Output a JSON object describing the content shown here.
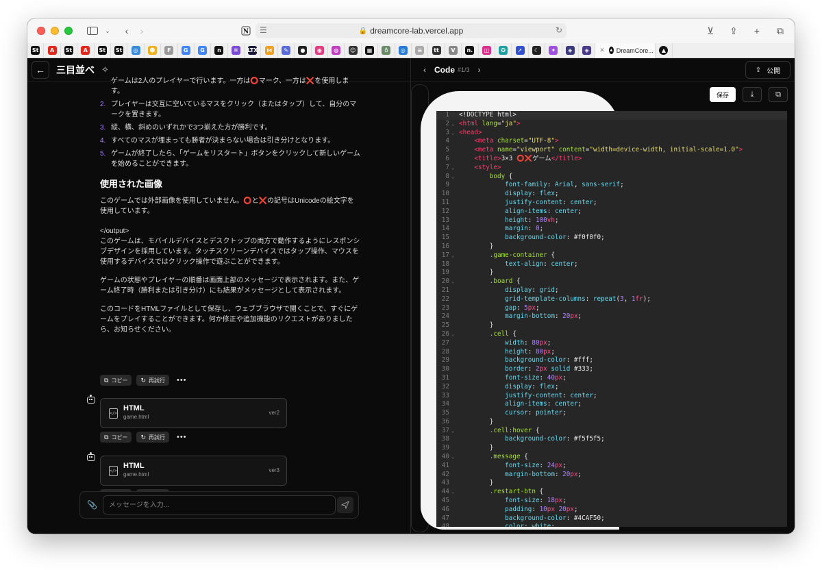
{
  "browser": {
    "url": "dreamcore-lab.vercel.app",
    "tab_title": "DreamCore...",
    "favorites": [
      {
        "label": "St",
        "color": "#111111"
      },
      {
        "label": "A",
        "color": "#e0281d"
      },
      {
        "label": "St",
        "color": "#111111"
      },
      {
        "label": "A",
        "color": "#e0281d"
      },
      {
        "label": "St",
        "color": "#111111"
      },
      {
        "label": "St",
        "color": "#111111"
      },
      {
        "label": "◎",
        "color": "#3a8bdc"
      },
      {
        "label": "☻",
        "color": "#f0b020"
      },
      {
        "label": "F",
        "color": "#9a9a9a"
      },
      {
        "label": "G",
        "color": "#4285f4"
      },
      {
        "label": "G",
        "color": "#4285f4"
      },
      {
        "label": "n",
        "color": "#111111"
      },
      {
        "label": "✲",
        "color": "#7b4bd8"
      },
      {
        "label": "LTX",
        "color": "#1a1a3a"
      },
      {
        "label": "⋈",
        "color": "#f0a020"
      },
      {
        "label": "✎",
        "color": "#5a6ad8"
      },
      {
        "label": "●",
        "color": "#222222"
      },
      {
        "label": "◉",
        "color": "#e04080"
      },
      {
        "label": "◍",
        "color": "#c040c0"
      },
      {
        "label": "☺",
        "color": "#333333"
      },
      {
        "label": "▦",
        "color": "#111111"
      },
      {
        "label": "♁",
        "color": "#6a8a6a"
      },
      {
        "label": "◎",
        "color": "#2a7ad8"
      },
      {
        "label": "≡",
        "color": "#aaaaaa"
      },
      {
        "label": "tt",
        "color": "#333333"
      },
      {
        "label": "V",
        "color": "#888888"
      },
      {
        "label": "n.",
        "color": "#111111"
      },
      {
        "label": "◫",
        "color": "#d8308a"
      },
      {
        "label": "✪",
        "color": "#20a0a0"
      },
      {
        "label": "➚",
        "color": "#3050d0"
      },
      {
        "label": "☾",
        "color": "#222222"
      },
      {
        "label": "✦",
        "color": "#a050e0"
      },
      {
        "label": "◈",
        "color": "#3a3a7a"
      },
      {
        "label": "◈",
        "color": "#4a3a8a"
      }
    ]
  },
  "chat": {
    "title": "三目並べ",
    "list_items": [
      {
        "num": "",
        "text": "ゲームは2人のプレイヤーで行います。一方は⭕マーク、一方は❌を使用します。"
      },
      {
        "num": "2.",
        "text": "プレイヤーは交互に空いているマスをクリック（またはタップ）して、自分のマークを置きます。"
      },
      {
        "num": "3.",
        "text": "縦、横、斜めのいずれかで3つ揃えた方が勝利です。"
      },
      {
        "num": "4.",
        "text": "すべてのマスが埋まっても勝者が決まらない場合は引き分けとなります。"
      },
      {
        "num": "5.",
        "text": "ゲームが終了したら、「ゲームをリスタート」ボタンをクリックして新しいゲームを始めることができます。"
      }
    ],
    "section_heading": "使用された画像",
    "images_para_a": "このゲームでは外部画像を使用していません。",
    "images_para_o": "⭕",
    "images_para_to": "と",
    "images_para_x": "❌",
    "images_para_b": "の記号はUnicodeの絵文字を使用しています。",
    "output_tag": "</output>",
    "para1": "このゲームは、モバイルデバイスとデスクトップの両方で動作するようにレスポンシブデザインを採用しています。タッチスクリーンデバイスではタップ操作、マウスを使用するデバイスではクリック操作で遊ぶことができます。",
    "para2": "ゲームの状態やプレイヤーの順番は画面上部のメッセージで表示されます。また、ゲーム終了時（勝利または引き分け）にも結果がメッセージとして表示されます。",
    "para3": "このコードをHTMLファイルとして保存し、ウェブブラウザで開くことで、すぐにゲームをプレイすることができます。何か修正や追加機能のリクエストがありましたら、お知らせください。",
    "copy_label": "コピー",
    "retry_label": "再試行",
    "more_label": "•••",
    "cards": [
      {
        "type": "HTML",
        "file": "game.html",
        "version": "ver2"
      },
      {
        "type": "HTML",
        "file": "game.html",
        "version": "ver3"
      }
    ],
    "input_placeholder": "メッセージを入力..."
  },
  "code_panel": {
    "title": "Code",
    "version": "#1/3",
    "publish_label": "公開",
    "save_label": "保存",
    "lines": [
      [
        [
          "plain",
          "<!DOCTYPE html>"
        ]
      ],
      [
        [
          "tag",
          "<html "
        ],
        [
          "attr",
          "lang"
        ],
        [
          "plain",
          "="
        ],
        [
          "str",
          "\"ja\""
        ],
        [
          "tag",
          ">"
        ]
      ],
      [
        [
          "tag",
          "<head>"
        ]
      ],
      [
        [
          "plain",
          "    "
        ],
        [
          "tag",
          "<meta "
        ],
        [
          "attr",
          "charset"
        ],
        [
          "plain",
          "="
        ],
        [
          "str",
          "\"UTF-8\""
        ],
        [
          "tag",
          ">"
        ]
      ],
      [
        [
          "plain",
          "    "
        ],
        [
          "tag",
          "<meta "
        ],
        [
          "attr",
          "name"
        ],
        [
          "plain",
          "="
        ],
        [
          "str",
          "\"viewport\""
        ],
        [
          "plain",
          " "
        ],
        [
          "attr",
          "content"
        ],
        [
          "plain",
          "="
        ],
        [
          "str",
          "\"width=device-width, initial-scale=1.0\""
        ],
        [
          "tag",
          ">"
        ]
      ],
      [
        [
          "plain",
          "    "
        ],
        [
          "tag",
          "<title>"
        ],
        [
          "plain",
          "3×3 ⭕❌ゲーム"
        ],
        [
          "tag",
          "</title>"
        ]
      ],
      [
        [
          "plain",
          "    "
        ],
        [
          "tag",
          "<style>"
        ]
      ],
      [
        [
          "plain",
          "        "
        ],
        [
          "sel",
          "body"
        ],
        [
          "plain",
          " {"
        ]
      ],
      [
        [
          "plain",
          "            "
        ],
        [
          "prop",
          "font-family"
        ],
        [
          "plain",
          ": "
        ],
        [
          "prop",
          "Arial"
        ],
        [
          "plain",
          ", "
        ],
        [
          "prop",
          "sans-serif"
        ],
        [
          "plain",
          ";"
        ]
      ],
      [
        [
          "plain",
          "            "
        ],
        [
          "prop",
          "display"
        ],
        [
          "plain",
          ": "
        ],
        [
          "prop",
          "flex"
        ],
        [
          "plain",
          ";"
        ]
      ],
      [
        [
          "plain",
          "            "
        ],
        [
          "prop",
          "justify-content"
        ],
        [
          "plain",
          ": "
        ],
        [
          "prop",
          "center"
        ],
        [
          "plain",
          ";"
        ]
      ],
      [
        [
          "plain",
          "            "
        ],
        [
          "prop",
          "align-items"
        ],
        [
          "plain",
          ": "
        ],
        [
          "prop",
          "center"
        ],
        [
          "plain",
          ";"
        ]
      ],
      [
        [
          "plain",
          "            "
        ],
        [
          "prop",
          "height"
        ],
        [
          "plain",
          ": "
        ],
        [
          "num",
          "100"
        ],
        [
          "unit",
          "vh"
        ],
        [
          "plain",
          ";"
        ]
      ],
      [
        [
          "plain",
          "            "
        ],
        [
          "prop",
          "margin"
        ],
        [
          "plain",
          ": "
        ],
        [
          "num",
          "0"
        ],
        [
          "plain",
          ";"
        ]
      ],
      [
        [
          "plain",
          "            "
        ],
        [
          "prop",
          "background-color"
        ],
        [
          "plain",
          ": #f0f0f0;"
        ]
      ],
      [
        [
          "plain",
          "        }"
        ]
      ],
      [
        [
          "plain",
          "        "
        ],
        [
          "sel",
          ".game-container"
        ],
        [
          "plain",
          " {"
        ]
      ],
      [
        [
          "plain",
          "            "
        ],
        [
          "prop",
          "text-align"
        ],
        [
          "plain",
          ": "
        ],
        [
          "prop",
          "center"
        ],
        [
          "plain",
          ";"
        ]
      ],
      [
        [
          "plain",
          "        }"
        ]
      ],
      [
        [
          "plain",
          "        "
        ],
        [
          "sel",
          ".board"
        ],
        [
          "plain",
          " {"
        ]
      ],
      [
        [
          "plain",
          "            "
        ],
        [
          "prop",
          "display"
        ],
        [
          "plain",
          ": "
        ],
        [
          "prop",
          "grid"
        ],
        [
          "plain",
          ";"
        ]
      ],
      [
        [
          "plain",
          "            "
        ],
        [
          "prop",
          "grid-template-columns"
        ],
        [
          "plain",
          ": "
        ],
        [
          "prop",
          "repeat"
        ],
        [
          "plain",
          "("
        ],
        [
          "num",
          "3"
        ],
        [
          "plain",
          ", "
        ],
        [
          "num",
          "1"
        ],
        [
          "unit",
          "fr"
        ],
        [
          "plain",
          ");"
        ]
      ],
      [
        [
          "plain",
          "            "
        ],
        [
          "prop",
          "gap"
        ],
        [
          "plain",
          ": "
        ],
        [
          "num",
          "5"
        ],
        [
          "unit",
          "px"
        ],
        [
          "plain",
          ";"
        ]
      ],
      [
        [
          "plain",
          "            "
        ],
        [
          "prop",
          "margin-bottom"
        ],
        [
          "plain",
          ": "
        ],
        [
          "num",
          "20"
        ],
        [
          "unit",
          "px"
        ],
        [
          "plain",
          ";"
        ]
      ],
      [
        [
          "plain",
          "        }"
        ]
      ],
      [
        [
          "plain",
          "        "
        ],
        [
          "sel",
          ".cell"
        ],
        [
          "plain",
          " {"
        ]
      ],
      [
        [
          "plain",
          "            "
        ],
        [
          "prop",
          "width"
        ],
        [
          "plain",
          ": "
        ],
        [
          "num",
          "80"
        ],
        [
          "unit",
          "px"
        ],
        [
          "plain",
          ";"
        ]
      ],
      [
        [
          "plain",
          "            "
        ],
        [
          "prop",
          "height"
        ],
        [
          "plain",
          ": "
        ],
        [
          "num",
          "80"
        ],
        [
          "unit",
          "px"
        ],
        [
          "plain",
          ";"
        ]
      ],
      [
        [
          "plain",
          "            "
        ],
        [
          "prop",
          "background-color"
        ],
        [
          "plain",
          ": #fff;"
        ]
      ],
      [
        [
          "plain",
          "            "
        ],
        [
          "prop",
          "border"
        ],
        [
          "plain",
          ": "
        ],
        [
          "num",
          "2"
        ],
        [
          "unit",
          "px"
        ],
        [
          "plain",
          " "
        ],
        [
          "prop",
          "solid"
        ],
        [
          "plain",
          " #333;"
        ]
      ],
      [
        [
          "plain",
          "            "
        ],
        [
          "prop",
          "font-size"
        ],
        [
          "plain",
          ": "
        ],
        [
          "num",
          "40"
        ],
        [
          "unit",
          "px"
        ],
        [
          "plain",
          ";"
        ]
      ],
      [
        [
          "plain",
          "            "
        ],
        [
          "prop",
          "display"
        ],
        [
          "plain",
          ": "
        ],
        [
          "prop",
          "flex"
        ],
        [
          "plain",
          ";"
        ]
      ],
      [
        [
          "plain",
          "            "
        ],
        [
          "prop",
          "justify-content"
        ],
        [
          "plain",
          ": "
        ],
        [
          "prop",
          "center"
        ],
        [
          "plain",
          ";"
        ]
      ],
      [
        [
          "plain",
          "            "
        ],
        [
          "prop",
          "align-items"
        ],
        [
          "plain",
          ": "
        ],
        [
          "prop",
          "center"
        ],
        [
          "plain",
          ";"
        ]
      ],
      [
        [
          "plain",
          "            "
        ],
        [
          "prop",
          "cursor"
        ],
        [
          "plain",
          ": "
        ],
        [
          "prop",
          "pointer"
        ],
        [
          "plain",
          ";"
        ]
      ],
      [
        [
          "plain",
          "        }"
        ]
      ],
      [
        [
          "plain",
          "        "
        ],
        [
          "sel",
          ".cell:hover"
        ],
        [
          "plain",
          " {"
        ]
      ],
      [
        [
          "plain",
          "            "
        ],
        [
          "prop",
          "background-color"
        ],
        [
          "plain",
          ": #f5f5f5;"
        ]
      ],
      [
        [
          "plain",
          "        }"
        ]
      ],
      [
        [
          "plain",
          "        "
        ],
        [
          "sel",
          ".message"
        ],
        [
          "plain",
          " {"
        ]
      ],
      [
        [
          "plain",
          "            "
        ],
        [
          "prop",
          "font-size"
        ],
        [
          "plain",
          ": "
        ],
        [
          "num",
          "24"
        ],
        [
          "unit",
          "px"
        ],
        [
          "plain",
          ";"
        ]
      ],
      [
        [
          "plain",
          "            "
        ],
        [
          "prop",
          "margin-bottom"
        ],
        [
          "plain",
          ": "
        ],
        [
          "num",
          "20"
        ],
        [
          "unit",
          "px"
        ],
        [
          "plain",
          ";"
        ]
      ],
      [
        [
          "plain",
          "        }"
        ]
      ],
      [
        [
          "plain",
          "        "
        ],
        [
          "sel",
          ".restart-btn"
        ],
        [
          "plain",
          " {"
        ]
      ],
      [
        [
          "plain",
          "            "
        ],
        [
          "prop",
          "font-size"
        ],
        [
          "plain",
          ": "
        ],
        [
          "num",
          "18"
        ],
        [
          "unit",
          "px"
        ],
        [
          "plain",
          ";"
        ]
      ],
      [
        [
          "plain",
          "            "
        ],
        [
          "prop",
          "padding"
        ],
        [
          "plain",
          ": "
        ],
        [
          "num",
          "10"
        ],
        [
          "unit",
          "px"
        ],
        [
          "plain",
          " "
        ],
        [
          "num",
          "20"
        ],
        [
          "unit",
          "px"
        ],
        [
          "plain",
          ";"
        ]
      ],
      [
        [
          "plain",
          "            "
        ],
        [
          "prop",
          "background-color"
        ],
        [
          "plain",
          ": #4CAF50;"
        ]
      ],
      [
        [
          "plain",
          "            "
        ],
        [
          "prop",
          "color"
        ],
        [
          "plain",
          ": "
        ],
        [
          "prop",
          "white"
        ],
        [
          "plain",
          ";"
        ]
      ]
    ],
    "fold_lines": [
      2,
      3,
      7,
      8,
      17,
      20,
      26,
      37,
      40,
      44
    ]
  }
}
